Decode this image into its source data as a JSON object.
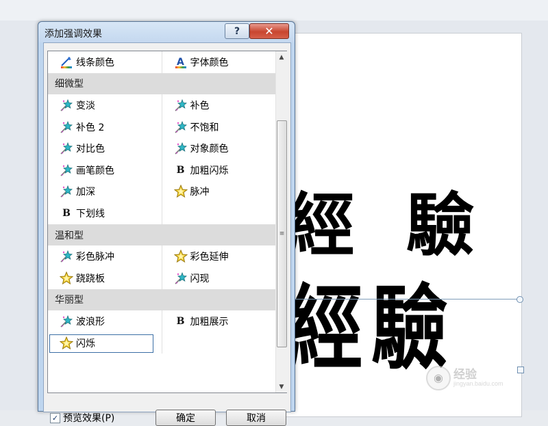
{
  "dialog": {
    "title": "添加强调效果",
    "help_label": "?",
    "close_label": "✕"
  },
  "effects": {
    "rows": [
      {
        "type": "items",
        "left": {
          "label": "线条颜色",
          "icon": "line-color-icon"
        },
        "right": {
          "label": "字体颜色",
          "icon": "font-color-icon"
        }
      },
      {
        "type": "header",
        "label": "细微型"
      },
      {
        "type": "items",
        "left": {
          "label": "变淡",
          "icon": "star-sparkle-icon"
        },
        "right": {
          "label": "补色",
          "icon": "star-sparkle-icon"
        }
      },
      {
        "type": "items",
        "left": {
          "label": "补色 2",
          "icon": "star-sparkle-icon"
        },
        "right": {
          "label": "不饱和",
          "icon": "star-sparkle-icon"
        }
      },
      {
        "type": "items",
        "left": {
          "label": "对比色",
          "icon": "star-sparkle-icon"
        },
        "right": {
          "label": "对象颜色",
          "icon": "star-sparkle-icon"
        }
      },
      {
        "type": "items",
        "left": {
          "label": "画笔颜色",
          "icon": "star-sparkle-icon"
        },
        "right": {
          "label": "加粗闪烁",
          "icon": "bold-b-icon"
        }
      },
      {
        "type": "items",
        "left": {
          "label": "加深",
          "icon": "star-sparkle-icon"
        },
        "right": {
          "label": "脉冲",
          "icon": "star-pulse-icon"
        }
      },
      {
        "type": "items",
        "left": {
          "label": "下划线",
          "icon": "bold-b-icon"
        },
        "right": null
      },
      {
        "type": "header",
        "label": "温和型"
      },
      {
        "type": "items",
        "left": {
          "label": "彩色脉冲",
          "icon": "star-sparkle-icon"
        },
        "right": {
          "label": "彩色延伸",
          "icon": "star-pulse-icon"
        }
      },
      {
        "type": "items",
        "left": {
          "label": "跷跷板",
          "icon": "star-pulse-icon"
        },
        "right": {
          "label": "闪现",
          "icon": "star-sparkle-icon"
        }
      },
      {
        "type": "header",
        "label": "华丽型"
      },
      {
        "type": "items",
        "left": {
          "label": "波浪形",
          "icon": "star-sparkle-icon"
        },
        "right": {
          "label": "加粗展示",
          "icon": "bold-b-icon"
        }
      },
      {
        "type": "items",
        "left": {
          "label": "闪烁",
          "icon": "star-pulse-icon",
          "selected": true
        },
        "right": null
      }
    ]
  },
  "footer": {
    "preview_label": "预览效果(P)",
    "preview_checked": true,
    "ok_label": "确定",
    "cancel_label": "取消"
  },
  "slide": {
    "chars_top": "經 驗",
    "chars_bottom": "經驗",
    "watermark_name": "经验",
    "watermark_url": "jingyan.baidu.com"
  },
  "colors": {
    "accent": "#3a6ea5",
    "close": "#c8452f",
    "header_bg": "#dcdcdc"
  }
}
